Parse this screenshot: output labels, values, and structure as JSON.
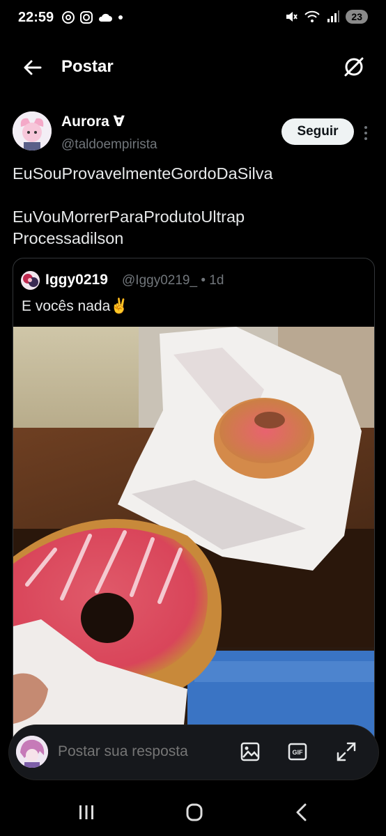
{
  "status": {
    "time": "22:59",
    "battery": "23"
  },
  "header": {
    "title": "Postar"
  },
  "post": {
    "author_name": "Aurora ∀",
    "author_handle": "@taldoempirista",
    "follow_label": "Seguir",
    "text_line1": "EuSouProvavelmenteGordoDaSilva",
    "text_line2": "EuVouMorrerParaProdutoUltrap",
    "text_line3": "Processadilson"
  },
  "quote": {
    "author_name": "Iggy0219",
    "author_handle": "@Iggy0219_",
    "separator": "•",
    "age": "1d",
    "text": "E vocês nada✌️"
  },
  "reply": {
    "placeholder": "Postar sua resposta",
    "gif_label": "GIF"
  },
  "colors": {
    "background": "#000000",
    "text": "#e7e9ea",
    "muted": "#71767b",
    "follow_bg": "#eff3f4",
    "border": "#333639"
  },
  "icons": [
    "back-arrow-icon",
    "filter-icon",
    "more-icon",
    "image-icon",
    "gif-icon",
    "expand-icon",
    "recents-icon",
    "home-icon",
    "back-icon"
  ]
}
